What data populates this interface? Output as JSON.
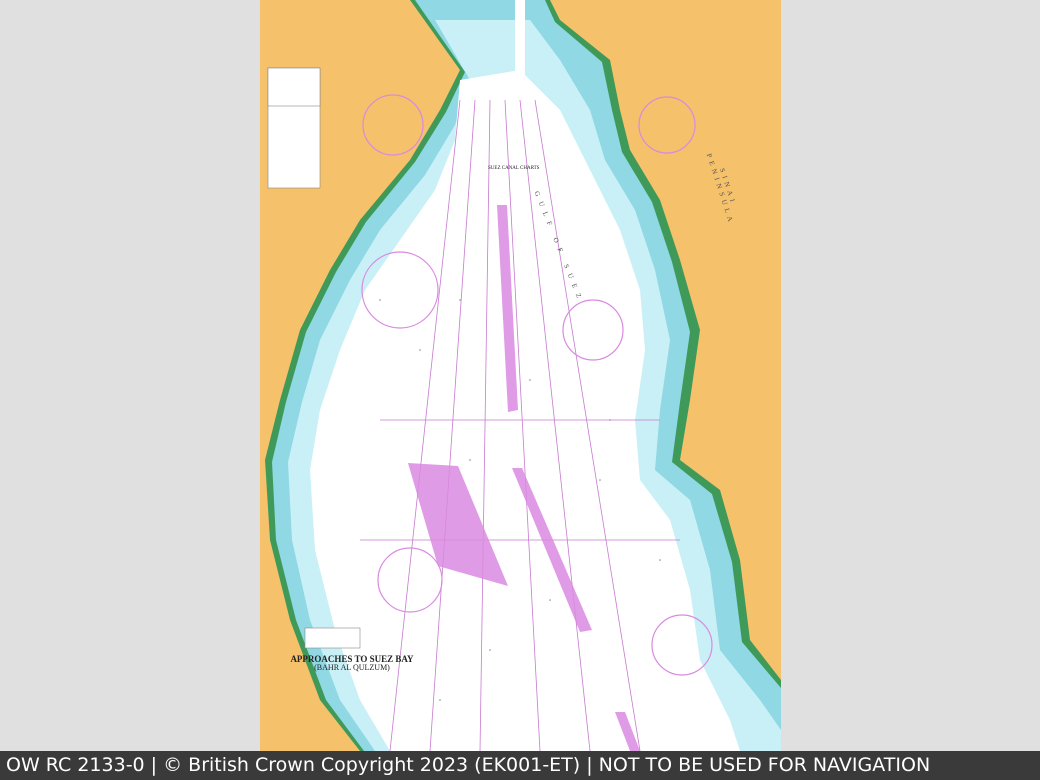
{
  "chart": {
    "title": "APPROACHES TO SUEZ BAY",
    "subtitle": "(BAHR AL QULZUM)",
    "region_gulf": "GULF OF SUEZ",
    "region_peninsula": "SINAI PENINSULA",
    "inset_label": "SUEZ CANAL CHARTS"
  },
  "footer": {
    "text": "OW RC 2133-0 | © British Crown Copyright 2023 (EK001-ET) | NOT TO BE USED FOR NAVIGATION"
  },
  "colors": {
    "land": "#f5c16a",
    "shallow": "#8fd8e4",
    "medium": "#c9f0f6",
    "deep": "#ffffff",
    "mangrove": "#3f9a5a",
    "restricted": "#d98ae0",
    "footer_bg": "#3a3a3a"
  }
}
